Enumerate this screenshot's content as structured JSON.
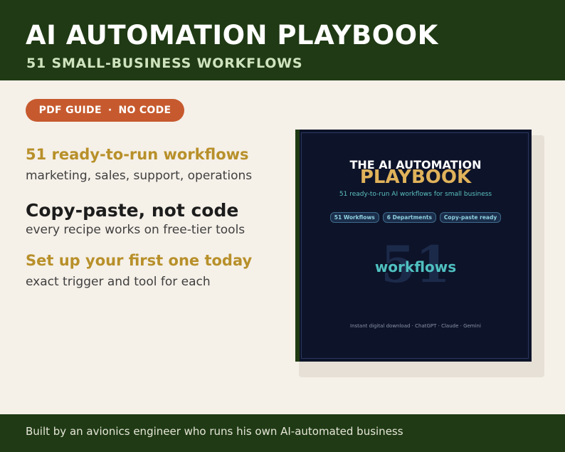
{
  "header": {
    "title": "AI AUTOMATION PLAYBOOK",
    "subtitle": "51 SMALL-BUSINESS WORKFLOWS"
  },
  "badge": {
    "left": "PDF GUIDE",
    "separator": "·",
    "right": "NO CODE"
  },
  "features": [
    {
      "heading": "51 ready-to-run workflows",
      "sub": "marketing, sales, support, operations"
    },
    {
      "heading": "Copy-paste, not code",
      "sub": "every recipe works on free-tier tools"
    },
    {
      "heading": "Set up your first one today",
      "sub": "exact trigger and tool for each"
    }
  ],
  "book": {
    "line1": "THE AI AUTOMATION",
    "line2": "PLAYBOOK",
    "tagline": "51 ready-to-run AI workflows for small business",
    "chips": [
      "51 Workflows",
      "6 Departments",
      "Copy-paste ready"
    ],
    "big_number": "51",
    "big_label": "workflows",
    "footer": "Instant digital download · ChatGPT · Claude · Gemini"
  },
  "footer": {
    "text": "Built by an avionics engineer who runs his own AI-automated business"
  },
  "colors": {
    "header_bg": "#1f3a14",
    "page_bg": "#f5f0e8",
    "badge_bg": "#c65a2e",
    "accent_gold": "#b8902a",
    "cover_bg": "#0d1329",
    "cover_teal": "#4fc0c0"
  }
}
